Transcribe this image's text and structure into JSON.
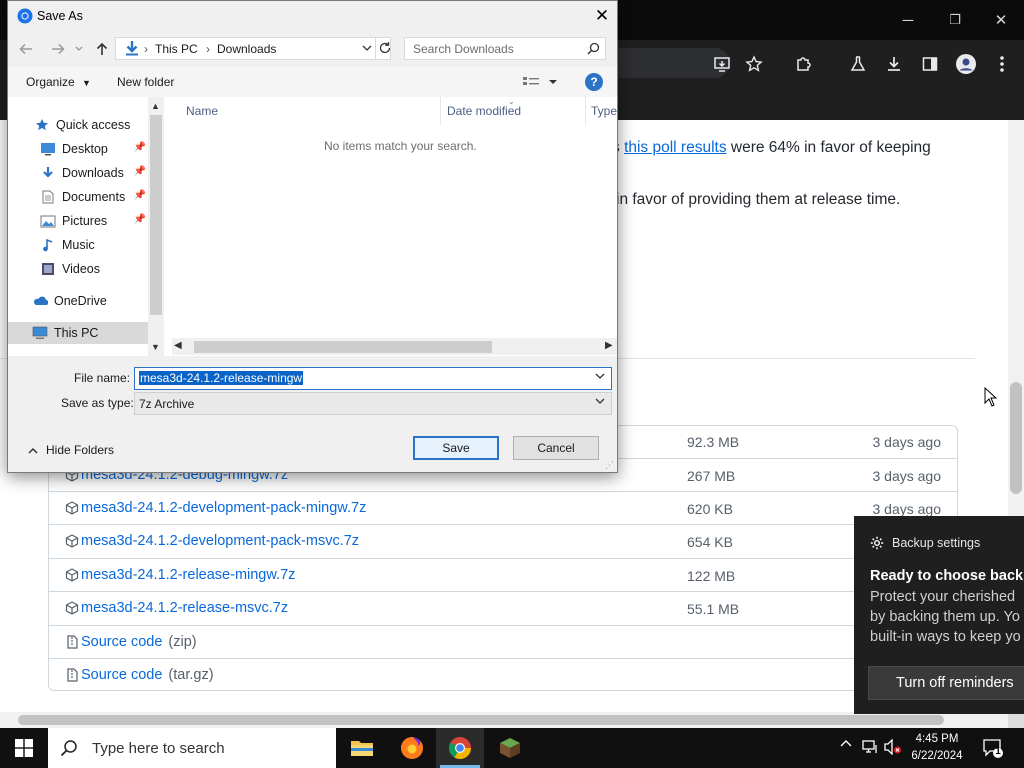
{
  "browser": {
    "window_controls": {
      "minimize": "─",
      "maximize": "❐",
      "close": "✕"
    },
    "page": {
      "para1_prefix": "s ",
      "para1_link": "this poll results",
      "para1_suffix": " were 64% in favor of keeping",
      "para2": "in favor of providing them at release time.",
      "assets": [
        {
          "name": "",
          "size": "92.3 MB",
          "date": "3 days ago",
          "kind": "package"
        },
        {
          "name": "mesa3d-24.1.2-debug-mingw.7z",
          "size": "267 MB",
          "date": "3 days ago",
          "kind": "package"
        },
        {
          "name": "mesa3d-24.1.2-development-pack-mingw.7z",
          "size": "620 KB",
          "date": "3 days ago",
          "kind": "package"
        },
        {
          "name": "mesa3d-24.1.2-development-pack-msvc.7z",
          "size": "654 KB",
          "date": "",
          "kind": "package"
        },
        {
          "name": "mesa3d-24.1.2-release-mingw.7z",
          "size": "122 MB",
          "date": "",
          "kind": "package"
        },
        {
          "name": "mesa3d-24.1.2-release-msvc.7z",
          "size": "55.1 MB",
          "date": "",
          "kind": "package"
        }
      ],
      "source_zip": {
        "label": "Source code",
        "suffix": "(zip)"
      },
      "source_tgz": {
        "label": "Source code",
        "suffix": "(tar.gz)"
      }
    }
  },
  "toast": {
    "header": "Backup settings",
    "title": "Ready to choose backu",
    "line1": "Protect your cherished",
    "line2": "by backing them up. Yo",
    "line3": "built-in ways to keep yo",
    "button": "Turn off reminders"
  },
  "dialog": {
    "title": "Save As",
    "close": "✕",
    "breadcrumb": [
      "This PC",
      "Downloads"
    ],
    "search_placeholder": "Search Downloads",
    "organize": "Organize",
    "new_folder": "New folder",
    "help": "?",
    "nav_items": [
      {
        "label": "Quick access",
        "icon": "star-icon"
      },
      {
        "label": "Desktop",
        "icon": "desktop-icon",
        "pinned": true
      },
      {
        "label": "Downloads",
        "icon": "download-icon",
        "pinned": true
      },
      {
        "label": "Documents",
        "icon": "document-icon",
        "pinned": true
      },
      {
        "label": "Pictures",
        "icon": "pictures-icon",
        "pinned": true
      },
      {
        "label": "Music",
        "icon": "music-icon"
      },
      {
        "label": "Videos",
        "icon": "videos-icon"
      },
      {
        "label": "OneDrive",
        "icon": "cloud-icon"
      },
      {
        "label": "This PC",
        "icon": "computer-icon",
        "selected": true
      }
    ],
    "columns": [
      "Name",
      "Date modified",
      "Type"
    ],
    "empty_message": "No items match your search.",
    "file_name_label": "File name:",
    "file_name_value": "mesa3d-24.1.2-release-mingw",
    "save_type_label": "Save as type:",
    "save_type_value": "7z Archive",
    "save_button": "Save",
    "cancel_button": "Cancel",
    "hide_folders": "Hide Folders"
  },
  "taskbar": {
    "search_placeholder": "Type here to search",
    "apps": [
      "file-explorer-icon",
      "firefox-icon",
      "chrome-icon",
      "minecraft-icon"
    ],
    "time": "4:45 PM",
    "date": "6/22/2024",
    "notification_count": "1"
  },
  "colors": {
    "accent": "#2a73c5",
    "link": "#0969da",
    "selection": "#0a64c8"
  }
}
